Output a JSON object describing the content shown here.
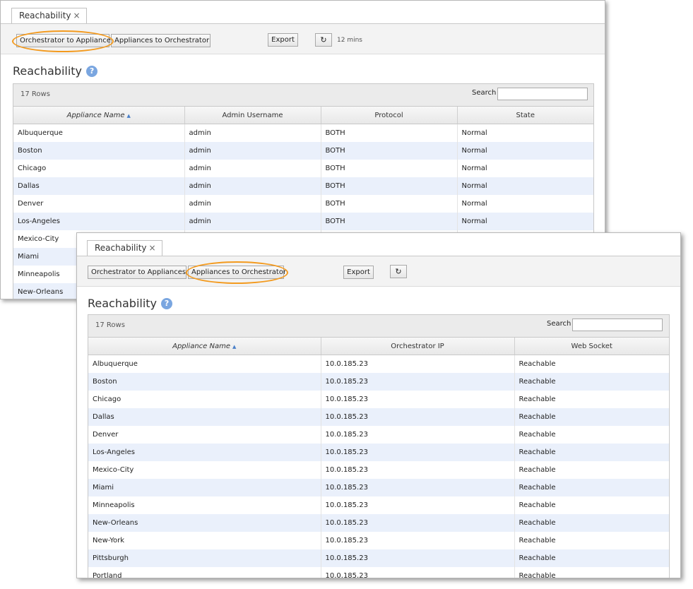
{
  "top": {
    "tab_label": "Reachability",
    "tab_close": "×",
    "buttons": {
      "orch_to_app": "Orchestrator to Appliances",
      "app_to_orch": "Appliances to Orchestrator",
      "export": "Export",
      "refresh": "↻",
      "refresh_interval": "12 mins"
    },
    "title": "Reachability",
    "help": "?",
    "rows_count": "17 Rows",
    "search_label": "Search",
    "search_value": "",
    "columns": [
      "Appliance Name",
      "Admin Username",
      "Protocol",
      "State"
    ],
    "sort_arrow": "▲",
    "rows": [
      [
        "Albuquerque",
        "admin",
        "BOTH",
        "Normal"
      ],
      [
        "Boston",
        "admin",
        "BOTH",
        "Normal"
      ],
      [
        "Chicago",
        "admin",
        "BOTH",
        "Normal"
      ],
      [
        "Dallas",
        "admin",
        "BOTH",
        "Normal"
      ],
      [
        "Denver",
        "admin",
        "BOTH",
        "Normal"
      ],
      [
        "Los-Angeles",
        "admin",
        "BOTH",
        "Normal"
      ],
      [
        "Mexico-City",
        "",
        "",
        ""
      ],
      [
        "Miami",
        "",
        "",
        ""
      ],
      [
        "Minneapolis",
        "",
        "",
        ""
      ],
      [
        "New-Orleans",
        "",
        "",
        ""
      ]
    ]
  },
  "bottom": {
    "tab_label": "Reachability",
    "tab_close": "×",
    "buttons": {
      "orch_to_app": "Orchestrator to Appliances",
      "app_to_orch": "Appliances to Orchestrator",
      "export": "Export",
      "refresh": "↻"
    },
    "title": "Reachability",
    "help": "?",
    "rows_count": "17 Rows",
    "search_label": "Search",
    "search_value": "",
    "columns": [
      "Appliance Name",
      "Orchestrator IP",
      "Web Socket"
    ],
    "sort_arrow": "▲",
    "rows": [
      [
        "Albuquerque",
        "10.0.185.23",
        "Reachable"
      ],
      [
        "Boston",
        "10.0.185.23",
        "Reachable"
      ],
      [
        "Chicago",
        "10.0.185.23",
        "Reachable"
      ],
      [
        "Dallas",
        "10.0.185.23",
        "Reachable"
      ],
      [
        "Denver",
        "10.0.185.23",
        "Reachable"
      ],
      [
        "Los-Angeles",
        "10.0.185.23",
        "Reachable"
      ],
      [
        "Mexico-City",
        "10.0.185.23",
        "Reachable"
      ],
      [
        "Miami",
        "10.0.185.23",
        "Reachable"
      ],
      [
        "Minneapolis",
        "10.0.185.23",
        "Reachable"
      ],
      [
        "New-Orleans",
        "10.0.185.23",
        "Reachable"
      ],
      [
        "New-York",
        "10.0.185.23",
        "Reachable"
      ],
      [
        "Pittsburgh",
        "10.0.185.23",
        "Reachable"
      ],
      [
        "Portland",
        "10.0.185.23",
        "Reachable"
      ]
    ]
  },
  "colors": {
    "highlight_ring": "#f39a1e",
    "row_alt": "#eaf0fb",
    "help_icon": "#7aa6e0"
  }
}
